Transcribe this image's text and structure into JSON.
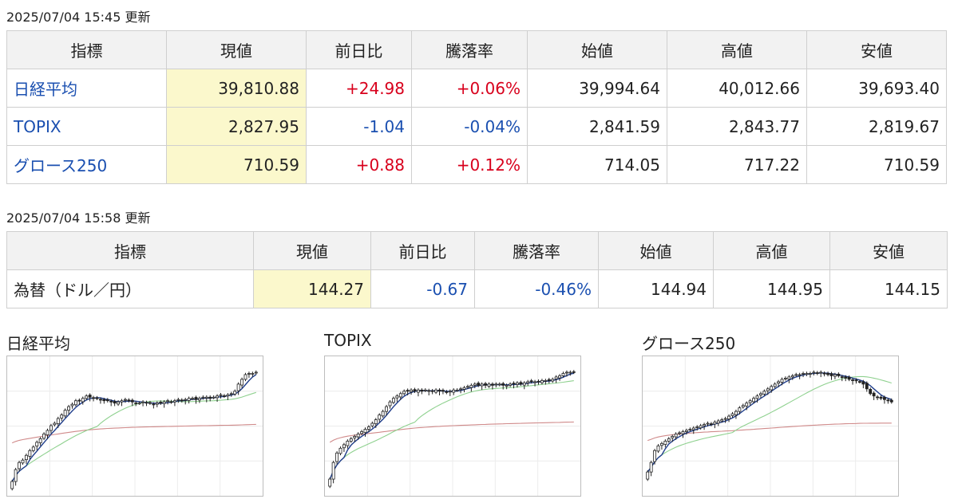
{
  "section1": {
    "timestamp": "2025/07/04 15:45 更新",
    "headers": [
      "指標",
      "現値",
      "前日比",
      "騰落率",
      "始値",
      "高値",
      "安値"
    ],
    "rows": [
      {
        "name": "日経平均",
        "current": "39,810.88",
        "change": "+24.98",
        "rate": "+0.06%",
        "open": "39,994.64",
        "high": "40,012.66",
        "low": "39,693.40",
        "direction": "up"
      },
      {
        "name": "TOPIX",
        "current": "2,827.95",
        "change": "-1.04",
        "rate": "-0.04%",
        "open": "2,841.59",
        "high": "2,843.77",
        "low": "2,819.67",
        "direction": "down"
      },
      {
        "name": "グロース250",
        "current": "710.59",
        "change": "+0.88",
        "rate": "+0.12%",
        "open": "714.05",
        "high": "717.22",
        "low": "710.59",
        "direction": "up"
      }
    ]
  },
  "section2": {
    "timestamp": "2025/07/04 15:58 更新",
    "headers": [
      "指標",
      "現値",
      "前日比",
      "騰落率",
      "始値",
      "高値",
      "安値"
    ],
    "rows": [
      {
        "name": "為替（ドル／円）",
        "current": "144.27",
        "change": "-0.67",
        "rate": "-0.46%",
        "open": "144.94",
        "high": "144.95",
        "low": "144.15",
        "direction": "down"
      }
    ]
  },
  "charts": [
    {
      "title": "日経平均",
      "chart_data": {
        "type": "candlestick",
        "note": "daily candles, scale not printed; values are relative price levels 0-100",
        "closes": [
          4,
          14,
          20,
          22,
          26,
          30,
          33,
          37,
          40,
          44,
          47,
          51,
          53,
          57,
          60,
          64,
          67,
          69,
          72,
          72,
          74,
          76,
          75,
          74,
          74,
          73,
          72,
          72,
          71,
          70,
          71,
          72,
          73,
          72,
          71,
          70,
          70,
          71,
          70,
          70,
          69,
          70,
          70,
          71,
          72,
          71,
          72,
          73,
          72,
          73,
          74,
          74,
          73,
          74,
          75,
          75,
          74,
          75,
          76,
          77,
          76,
          77,
          78,
          80,
          86,
          90,
          94,
          95,
          95,
          96
        ]
      },
      "ma_colors": [
        "#1f3d8a",
        "#8fd18f",
        "#d08a8a"
      ]
    },
    {
      "title": "TOPIX",
      "chart_data": {
        "type": "candlestick",
        "note": "daily candles, scale not printed; values are relative price levels 0-100",
        "closes": [
          6,
          20,
          28,
          32,
          35,
          38,
          40,
          42,
          44,
          46,
          48,
          50,
          53,
          56,
          60,
          63,
          67,
          71,
          74,
          76,
          78,
          80,
          80,
          81,
          80,
          81,
          80,
          81,
          80,
          80,
          81,
          80,
          80,
          79,
          80,
          81,
          81,
          82,
          83,
          84,
          85,
          86,
          85,
          86,
          85,
          86,
          85,
          86,
          86,
          85,
          85,
          86,
          86,
          87,
          86,
          87,
          88,
          88,
          88,
          88,
          89,
          89,
          89,
          90,
          92,
          93,
          95,
          96,
          96,
          96
        ]
      },
      "ma_colors": [
        "#1f3d8a",
        "#8fd18f",
        "#d08a8a"
      ]
    },
    {
      "title": "グロース250",
      "chart_data": {
        "type": "candlestick",
        "note": "daily candles, scale not printed; values are relative price levels 0-100",
        "closes": [
          12,
          20,
          30,
          34,
          36,
          38,
          40,
          42,
          44,
          45,
          46,
          47,
          48,
          49,
          50,
          51,
          52,
          53,
          52,
          54,
          55,
          56,
          57,
          59,
          61,
          63,
          66,
          68,
          70,
          72,
          74,
          76,
          78,
          80,
          82,
          84,
          86,
          88,
          90,
          91,
          92,
          93,
          94,
          94,
          95,
          95,
          95,
          96,
          95,
          96,
          95,
          94,
          93,
          94,
          93,
          92,
          91,
          90,
          89,
          89,
          88,
          86,
          82,
          78,
          76,
          75,
          74,
          73,
          72,
          71
        ]
      },
      "ma_colors": [
        "#1f3d8a",
        "#8fd18f",
        "#d08a8a"
      ]
    }
  ]
}
